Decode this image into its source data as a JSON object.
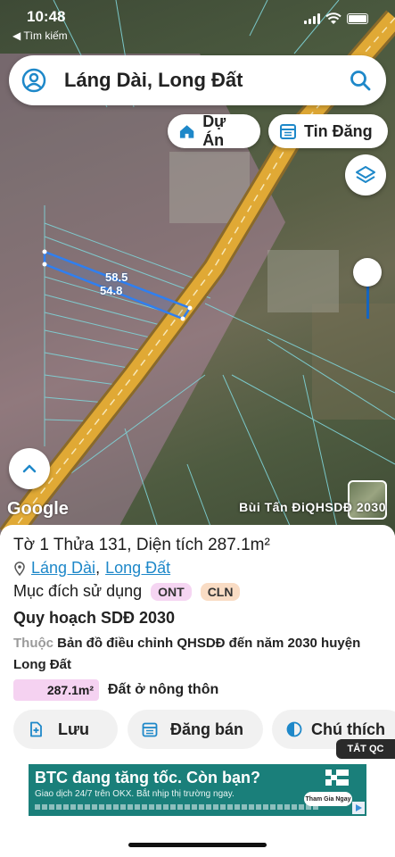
{
  "status_bar": {
    "time": "10:48",
    "back_label": "◀ Tìm kiếm"
  },
  "search": {
    "query": "Láng Dài, Long Đất"
  },
  "chips": {
    "project": "Dự Án",
    "listing": "Tin Đăng"
  },
  "map": {
    "dimensions": {
      "top": "58.5",
      "side": "54.8"
    },
    "google_logo": "Google",
    "watermark": "Bùi Tấn ĐiQHSDĐ 2030",
    "road_color": "#e0a935",
    "plot_line_color": "#7fd3d7",
    "selection_color": "#2f7ff0"
  },
  "parcel": {
    "title": "Tờ 1 Thửa 131, Diện tích 287.1m²",
    "commune": "Láng Dài",
    "separator": ",",
    "district": "Long Đất",
    "purpose_label": "Mục đích sử dụng",
    "purpose_tags": [
      "ONT",
      "CLN"
    ],
    "plan_title": "Quy hoạch SDĐ 2030",
    "plan_prefix": "Thuộc",
    "plan_desc": "Bản đồ điều chỉnh QHSDĐ đến năm 2030 huyện Long Đất",
    "area_value": "287.1m²",
    "land_type": "Đất ở nông thôn"
  },
  "actions": {
    "save": "Lưu",
    "sell": "Đăng bán",
    "legend": "Chú thích"
  },
  "close_ads": "TẮT QC",
  "ad": {
    "headline": "BTC đang tăng tốc. Còn bạn?",
    "sub": "Giao dịch 24/7 trên OKX. Bắt nhịp thị trường ngay.",
    "cta": "Tham Gia Ngay"
  }
}
